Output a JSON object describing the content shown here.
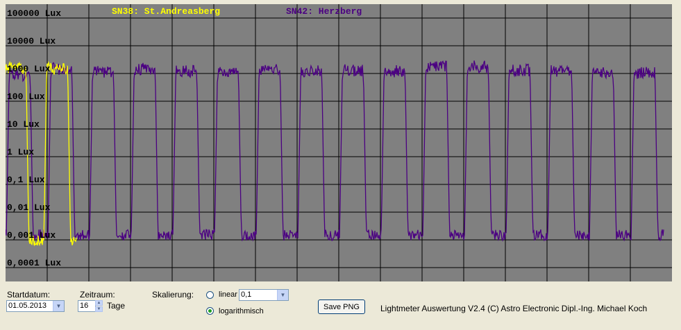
{
  "chart_data": {
    "type": "line",
    "legend": [
      {
        "name": "SN38: St.Andreasberg",
        "color": "#ffff00"
      },
      {
        "name": "SN42: Herzberg",
        "color": "#4b0082"
      }
    ],
    "y_scale": "log",
    "ylim": [
      0.0001,
      100000
    ],
    "y_ticks": [
      "100000 Lux",
      "10000 Lux",
      "1000 Lux",
      "100 Lux",
      "10 Lux",
      "1 Lux",
      "0,1 Lux",
      "0,01 Lux",
      "0,001 Lux",
      "0,0001 Lux"
    ],
    "x_days": 16,
    "grid": true,
    "series": [
      {
        "name": "SN42: Herzberg",
        "color": "#4b0082",
        "day_peaks": [
          1500,
          2500,
          2000,
          2500,
          2000,
          1800,
          2500,
          2000,
          2200,
          2000,
          3000,
          3000,
          2200,
          2000,
          1800,
          1800
        ],
        "night_level": 0.0015
      },
      {
        "name": "SN38: St.Andreasberg",
        "color": "#ffff00",
        "day_peaks": [
          2500,
          2500
        ],
        "night_level": 0.001
      }
    ]
  },
  "controls": {
    "startdatum_label": "Startdatum:",
    "startdatum_value": "01.05.2013",
    "zeitraum_label": "Zeitraum:",
    "zeitraum_value": "16",
    "tage_label": "Tage",
    "skalierung_label": "Skalierung:",
    "linear_label": "linear",
    "linear_value": "0,1",
    "log_label": "logarithmisch",
    "save_label": "Save PNG",
    "footer_text": "Lightmeter Auswertung V2.4  (C) Astro Electronic Dipl.-Ing. Michael Koch"
  }
}
